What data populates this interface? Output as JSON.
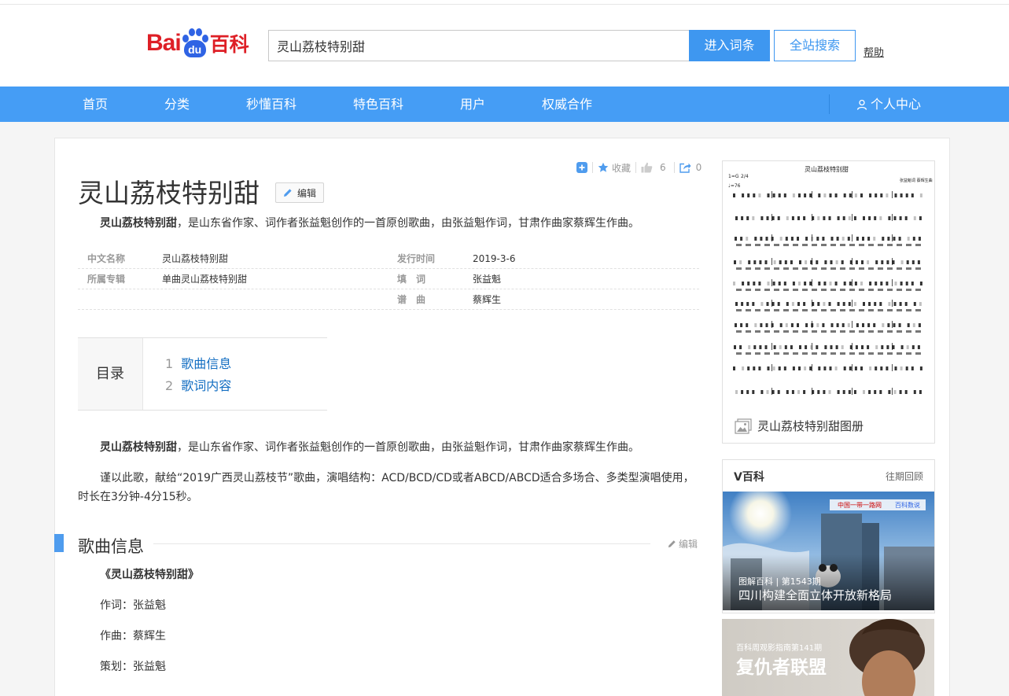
{
  "header": {
    "logo_bai": "Bai",
    "logo_du": "du",
    "logo_baike": "百科",
    "search_value": "灵山荔枝特别甜",
    "enter_button": "进入词条",
    "site_search_button": "全站搜索",
    "help_link": "帮助"
  },
  "nav": {
    "items": [
      "首页",
      "分类",
      "秒懂百科",
      "特色百科",
      "用户",
      "权威合作"
    ],
    "user_center": "个人中心"
  },
  "toolbar": {
    "collect_label": "收藏",
    "like_count": "6",
    "share_count": "0"
  },
  "article": {
    "title": "灵山荔枝特别甜",
    "edit_label": "编辑",
    "summary_bold": "灵山荔枝特别甜",
    "summary_rest": "，是山东省作家、词作者张益魁创作的一首原创歌曲，由张益魁作词，甘肃作曲家蔡辉生作曲。",
    "infobox": {
      "row1_k1": "中文名称",
      "row1_v1": "灵山荔枝特别甜",
      "row1_k2": "发行时间",
      "row1_v2": "2019-3-6",
      "row2_k1": "所属专辑",
      "row2_v1": "单曲灵山荔枝特别甜",
      "row2_k2": "填　词",
      "row2_v2": "张益魁",
      "row3_k2": "谱　曲",
      "row3_v2": "蔡辉生"
    },
    "catalog": {
      "head": "目录",
      "items": [
        {
          "num": "1",
          "label": "歌曲信息"
        },
        {
          "num": "2",
          "label": "歌词内容"
        }
      ]
    },
    "para1_bold": "灵山荔枝特别甜",
    "para1_rest": "，是山东省作家、词作者张益魁创作的一首原创歌曲，由张益魁作词，甘肃作曲家蔡辉生作曲。",
    "para2": "谨以此歌，献给“2019广西灵山荔枝节”歌曲，演唱结构：ACD/BCD/CD或者ABCD/ABCD适合多场合、多类型演唱使用，时长在3分钟-4分15秒。",
    "section_title": "歌曲信息",
    "section_edit": "编辑",
    "song_title": "《灵山荔枝特别甜》",
    "lyricist": "作词：张益魁",
    "composer": "作曲：蔡辉生",
    "planner": "策划：张益魁"
  },
  "sidebar": {
    "sheet_title": "灵山荔枝特别甜",
    "sheet_credits": "张益魁词\n蔡辉生曲",
    "sheet_key": "1=G",
    "sheet_time": "2/4",
    "sheet_tempo": "♩=76",
    "album_caption": "灵山荔枝特别甜图册",
    "vbaike_title": "V百科",
    "vbaike_more": "往期回顾",
    "vbaike_logo_text": "中国一带一路网",
    "vbaike_partner": "百科数说",
    "vbaike_tag": "图解百科 | 第1543期",
    "vbaike_headline": "四川构建全面立体开放新格局",
    "movie_tag": "百科周观影指南第141期",
    "movie_title": "复仇者联盟"
  }
}
